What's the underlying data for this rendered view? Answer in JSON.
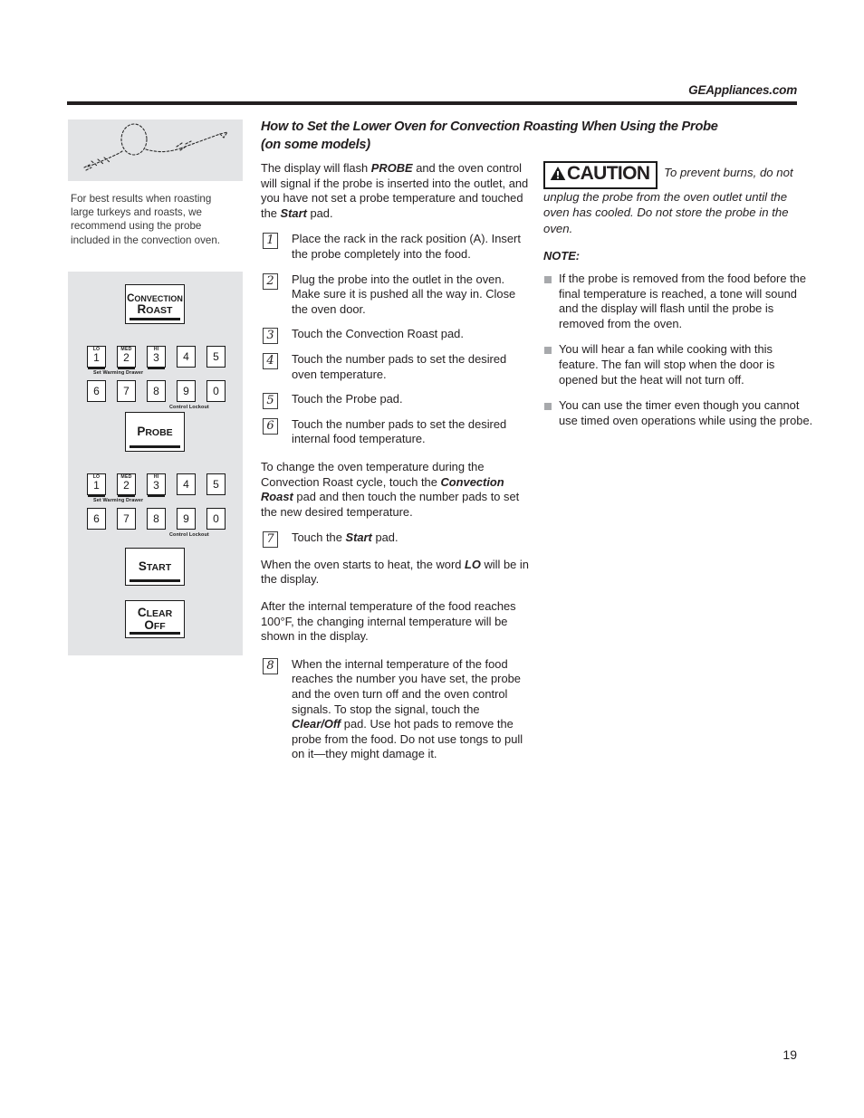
{
  "header": {
    "site_url": "GEAppliances.com"
  },
  "sidebar": {
    "illustration_name": "oven-temperature-probe-illustration",
    "caption": "For best results when roasting large turkeys and roasts, we recommend using the probe included in the convection oven."
  },
  "control_panel": {
    "convection_roast_pad": {
      "line1": "Convection",
      "line2": "Roast"
    },
    "probe_pad": {
      "line1": "Probe"
    },
    "start_pad": {
      "line1": "Start"
    },
    "clear_off_pad": {
      "line1": "Clear",
      "line2": "Off"
    },
    "keypad_row1": [
      {
        "top": "LO",
        "digit": "1"
      },
      {
        "top": "MED",
        "digit": "2"
      },
      {
        "top": "HI",
        "digit": "3"
      },
      {
        "top": "",
        "digit": "4"
      },
      {
        "top": "",
        "digit": "5"
      }
    ],
    "keypad_row2": [
      {
        "top": "",
        "digit": "6"
      },
      {
        "top": "",
        "digit": "7"
      },
      {
        "top": "",
        "digit": "8"
      },
      {
        "top": "",
        "digit": "9"
      },
      {
        "top": "",
        "digit": "0"
      }
    ],
    "set_warming_drawer_label": "Set Warming Drawer",
    "control_lockout_label": "Control Lockout"
  },
  "main": {
    "heading_line1": "How to Set the Lower Oven for Convection Roasting When Using the Probe",
    "heading_line2": "(on some models)",
    "intro": {
      "before": "The display will flash ",
      "bold1": "PROBE",
      "middle": " and the oven control will signal if the probe is inserted into the outlet, and you have not set a probe temperature and touched the ",
      "bold2": "Start",
      "after": " pad."
    },
    "steps": [
      {
        "num": "1",
        "text": "Place the rack in the rack position (A). Insert the probe completely into the food."
      },
      {
        "num": "2",
        "text": "Plug the probe into the outlet in the oven. Make sure it is pushed all the way in. Close the oven door."
      },
      {
        "num": "3",
        "text": "Touch the Convection Roast pad."
      },
      {
        "num": "4",
        "text": "Touch the number pads to set the desired oven temperature."
      },
      {
        "num": "5",
        "text": "Touch the Probe pad."
      },
      {
        "num": "6",
        "text": "Touch the number pads to set the desired internal food temperature."
      }
    ],
    "change_temp_para": {
      "before": "To change the oven temperature during the Convection Roast cycle, touch the ",
      "bold": "Convection Roast",
      "after": " pad and then touch the number pads to set the new desired temperature."
    },
    "step7": {
      "num": "7",
      "before": "Touch the ",
      "bold": "Start",
      "after": " pad."
    },
    "heat_para": {
      "before": "When the oven starts to heat, the word ",
      "bold": "LO",
      "after": " will be in the display."
    },
    "internal_temp_para": "After the internal temperature of the food reaches 100°F, the changing internal temperature will be shown in the display.",
    "step8": {
      "num": "8",
      "before": "When the internal temperature of the food reaches the number you have set, the probe and the oven turn off and the oven control signals. To stop the signal, touch the ",
      "bold": "Clear/Off",
      "after": " pad. Use hot pads to remove the probe from the food. Do not use tongs to pull on it—they might damage it."
    }
  },
  "caution": {
    "badge_text": "CAUTION",
    "badge_icon": "warning-triangle-icon",
    "text": " To prevent burns, do not unplug the probe from the oven outlet until the oven has cooled. Do not store the probe in the oven."
  },
  "note": {
    "label": "NOTE:",
    "bullets": [
      "If the probe is removed from the food before the final temperature is reached, a tone will sound and the display will flash until the probe is removed from the oven.",
      "You will hear a fan while cooking with this feature. The fan will stop when the door is opened but the heat will not turn off.",
      "You can use the timer even though you cannot use timed oven operations while using the probe."
    ]
  },
  "footer": {
    "page_number": "19"
  },
  "colors": {
    "panel_gray": "#e3e4e6",
    "bullet_gray": "#a7a9ac",
    "ink": "#231f20"
  }
}
